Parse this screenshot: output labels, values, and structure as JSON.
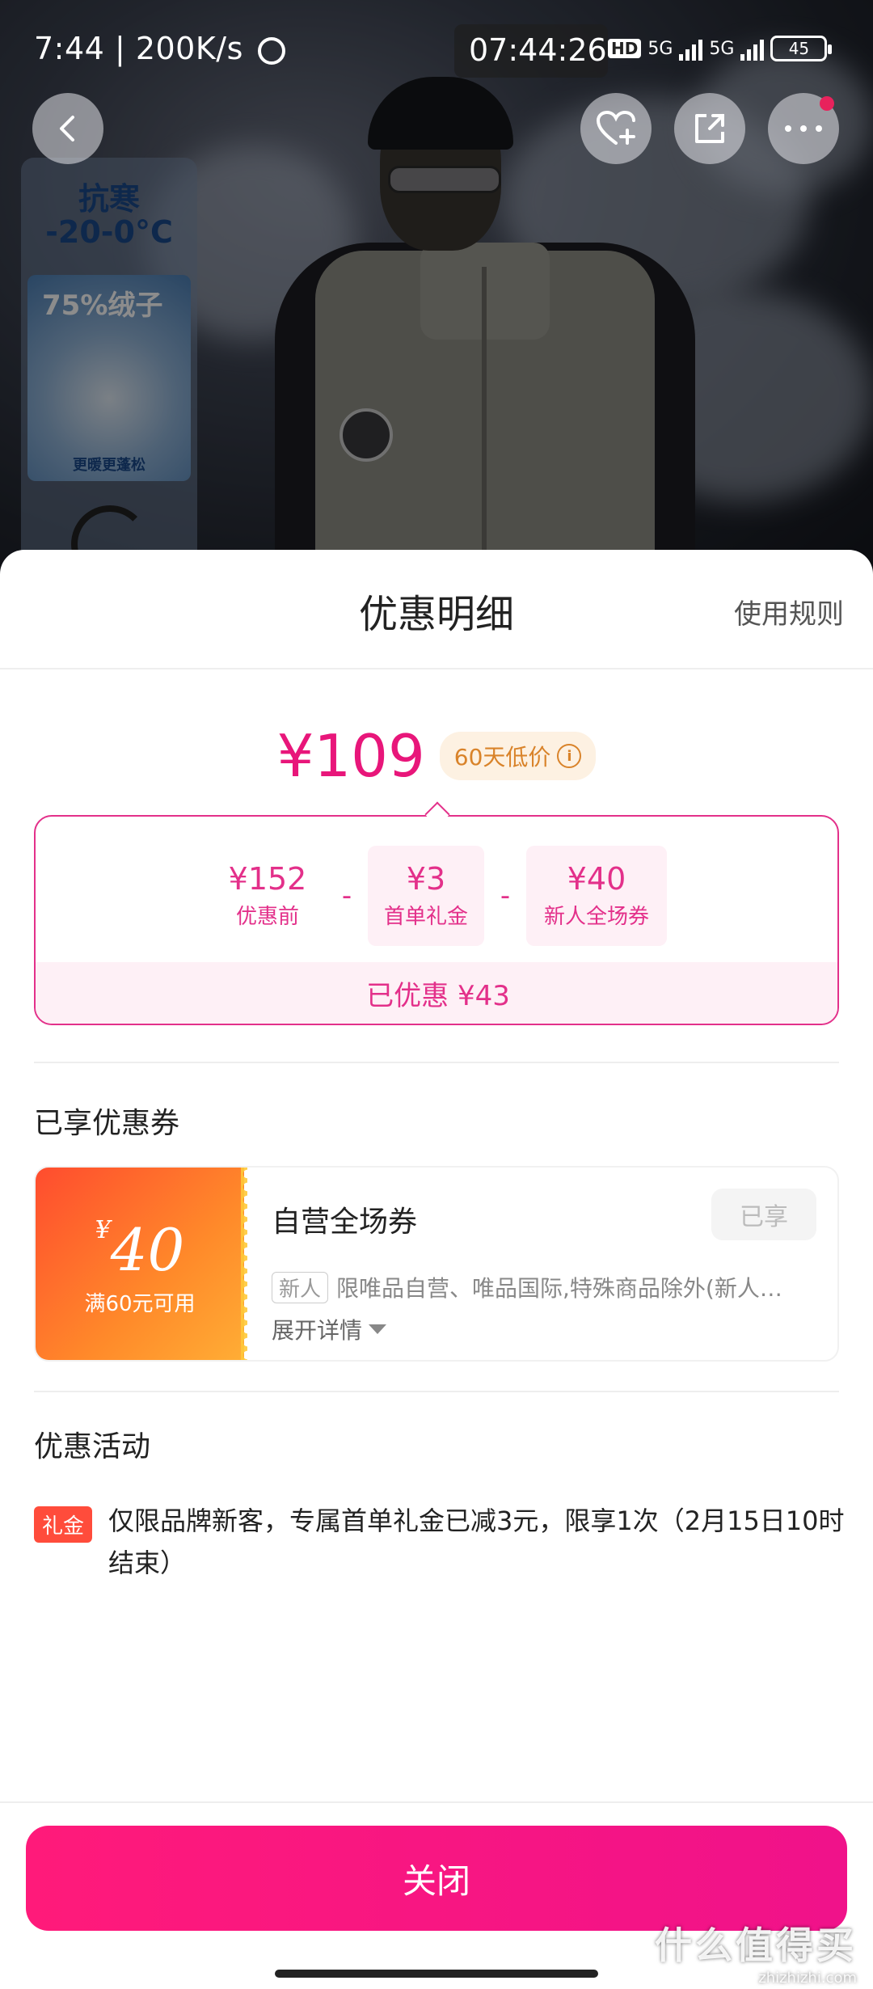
{
  "status_bar": {
    "time": "7:44",
    "speed": "200K/s",
    "clock": "07:44:26",
    "hd": "HD",
    "net1": "5G",
    "net2": "5G",
    "battery": "45"
  },
  "product_badges": {
    "title_line1": "抗寒",
    "title_line2": "-20-0°C",
    "feather_title": "75%绒子",
    "feather_footer": "更暖更蓬松"
  },
  "icons": [
    "back-icon",
    "favorite-add-icon",
    "share-icon",
    "more-icon",
    "info-icon",
    "alarm-icon"
  ],
  "sheet": {
    "title": "优惠明细",
    "rules_link": "使用规则",
    "final_price": "¥109",
    "low_price_tag": "60天低价",
    "breakdown": [
      {
        "value": "¥152",
        "label": "优惠前"
      },
      {
        "value": "¥3",
        "label": "首单礼金"
      },
      {
        "value": "¥40",
        "label": "新人全场券"
      }
    ],
    "operator": "-",
    "total_saved": "已优惠 ¥43"
  },
  "coupons_section": {
    "title": "已享优惠券",
    "coupon": {
      "currency": "¥",
      "amount": "40",
      "condition": "满60元可用",
      "name": "自营全场券",
      "status_button": "已享",
      "tag": "新人",
      "description": "限唯品自营、唯品国际,特殊商品除外(新人…",
      "expand": "展开详情"
    }
  },
  "activity_section": {
    "title": "优惠活动",
    "tag": "礼金",
    "text": "仅限品牌新客，专属首单礼金已减3元，限享1次（2月15日10时结束）"
  },
  "close_button": "关闭",
  "watermark": {
    "main": "什么值得买",
    "sub": "zhizhizhi.com"
  },
  "colors": {
    "accent": "#e8167a",
    "coupon_gradient_start": "#ff4c2e",
    "coupon_gradient_end": "#ffae35",
    "low_tag": "#d9832a"
  }
}
